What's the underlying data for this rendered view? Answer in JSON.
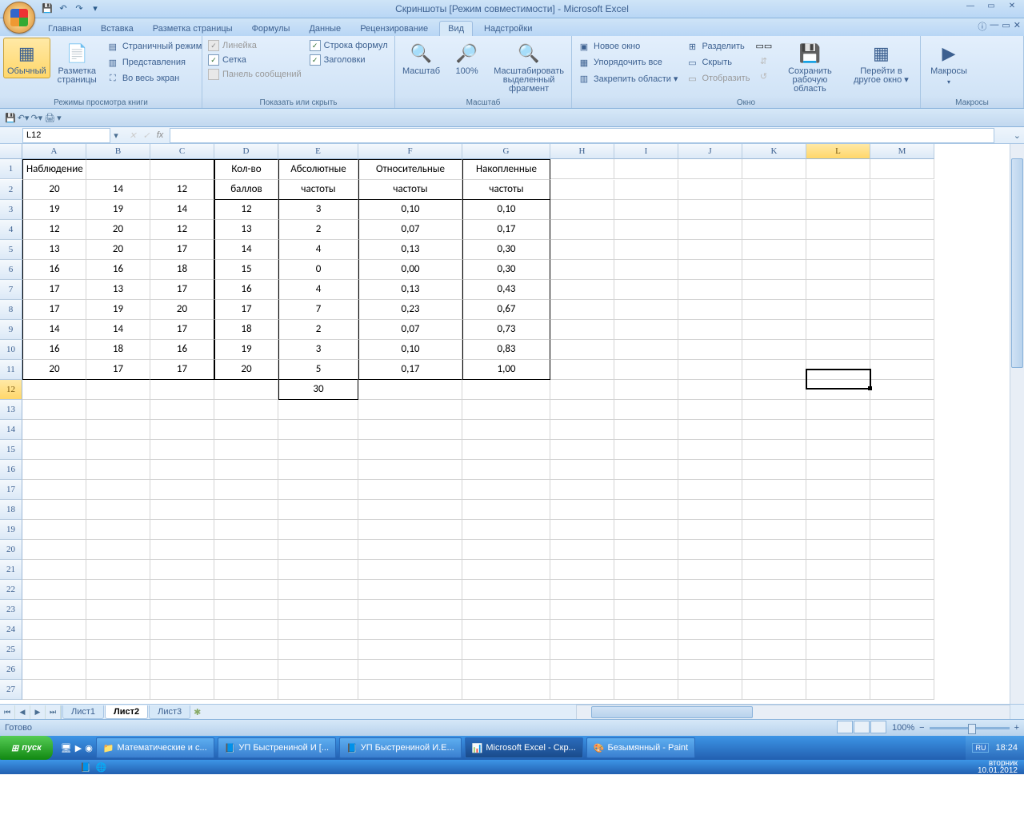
{
  "title": "Скриншоты  [Режим совместимости] - Microsoft Excel",
  "tabs": [
    "Главная",
    "Вставка",
    "Разметка страницы",
    "Формулы",
    "Данные",
    "Рецензирование",
    "Вид",
    "Надстройки"
  ],
  "activeTab": "Вид",
  "ribbon": {
    "group1": {
      "btn1": "Обычный",
      "btn2": "Разметка страницы",
      "i1": "Страничный режим",
      "i2": "Представления",
      "i3": "Во весь экран",
      "label": "Режимы просмотра книги"
    },
    "group2": {
      "c1": "Линейка",
      "c2": "Сетка",
      "c3": "Панель сообщений",
      "c4": "Строка формул",
      "c5": "Заголовки",
      "label": "Показать или скрыть"
    },
    "group3": {
      "b1": "Масштаб",
      "b2": "100%",
      "b3": "Масштабировать выделенный фрагмент",
      "label": "Масштаб"
    },
    "group4": {
      "i1": "Новое окно",
      "i2": "Упорядочить все",
      "i3": "Закрепить области ▾",
      "i4": "Разделить",
      "i5": "Скрыть",
      "i6": "Отобразить",
      "b1": "Сохранить рабочую область",
      "b2": "Перейти в другое окно ▾",
      "label": "Окно"
    },
    "group5": {
      "b1": "Макросы",
      "label": "Макросы"
    }
  },
  "namebox": "L12",
  "columns": [
    "A",
    "B",
    "C",
    "D",
    "E",
    "F",
    "G",
    "H",
    "I",
    "J",
    "K",
    "L",
    "M"
  ],
  "rows": [
    [
      "Наблюдение",
      "",
      "",
      "Кол-во",
      "Абсолютные",
      "Относительные",
      "Накопленные",
      "",
      "",
      "",
      "",
      "",
      ""
    ],
    [
      "20",
      "14",
      "12",
      "баллов",
      "частоты",
      "частоты",
      "частоты",
      "",
      "",
      "",
      "",
      "",
      ""
    ],
    [
      "19",
      "19",
      "14",
      "12",
      "3",
      "0,10",
      "0,10",
      "",
      "",
      "",
      "",
      "",
      ""
    ],
    [
      "12",
      "20",
      "12",
      "13",
      "2",
      "0,07",
      "0,17",
      "",
      "",
      "",
      "",
      "",
      ""
    ],
    [
      "13",
      "20",
      "17",
      "14",
      "4",
      "0,13",
      "0,30",
      "",
      "",
      "",
      "",
      "",
      ""
    ],
    [
      "16",
      "16",
      "18",
      "15",
      "0",
      "0,00",
      "0,30",
      "",
      "",
      "",
      "",
      "",
      ""
    ],
    [
      "17",
      "13",
      "17",
      "16",
      "4",
      "0,13",
      "0,43",
      "",
      "",
      "",
      "",
      "",
      ""
    ],
    [
      "17",
      "19",
      "20",
      "17",
      "7",
      "0,23",
      "0,67",
      "",
      "",
      "",
      "",
      "",
      ""
    ],
    [
      "14",
      "14",
      "17",
      "18",
      "2",
      "0,07",
      "0,73",
      "",
      "",
      "",
      "",
      "",
      ""
    ],
    [
      "16",
      "18",
      "16",
      "19",
      "3",
      "0,10",
      "0,83",
      "",
      "",
      "",
      "",
      "",
      ""
    ],
    [
      "20",
      "17",
      "17",
      "20",
      "5",
      "0,17",
      "1,00",
      "",
      "",
      "",
      "",
      "",
      ""
    ],
    [
      "",
      "",
      "",
      "",
      "30",
      "",
      "",
      "",
      "",
      "",
      "",
      "",
      ""
    ]
  ],
  "sheets": [
    "Лист1",
    "Лист2",
    "Лист3"
  ],
  "activeSheet": "Лист2",
  "status": "Готово",
  "zoom": "100%",
  "taskbar": {
    "start": "пуск",
    "tasks": [
      "Математические и с...",
      "УП Быстрениной И [...",
      "УП Быстрениной И.Е...",
      "Microsoft Excel - Скр...",
      "Безымянный - Paint"
    ],
    "activeTask": 3,
    "lang": "RU",
    "time": "18:24",
    "day": "вторник",
    "date": "10.01.2012"
  }
}
